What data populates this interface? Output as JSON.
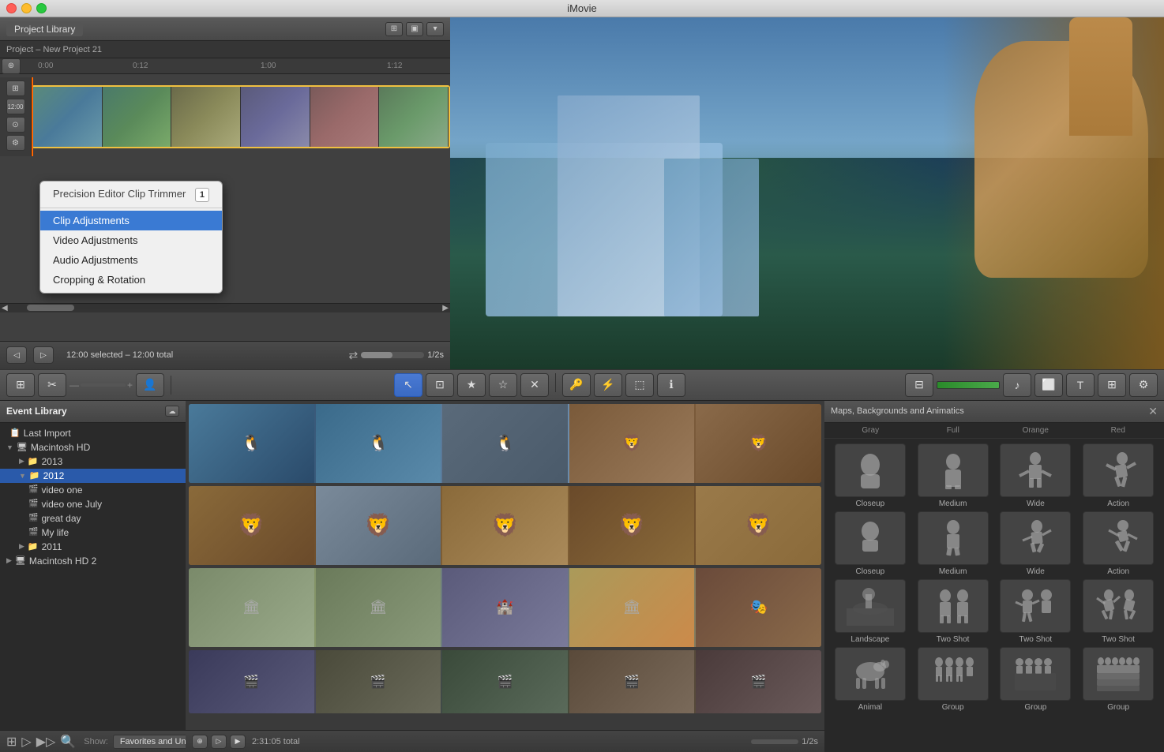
{
  "app": {
    "title": "iMovie",
    "window_controls": {
      "close": "close",
      "minimize": "minimize",
      "maximize": "maximize"
    }
  },
  "project": {
    "tab_label": "Project Library",
    "title": "Project – New Project 21",
    "timecodes": [
      "0:00",
      "0:12",
      "1:00",
      "1:12"
    ],
    "selected_time": "12:00 selected – 12:00 total",
    "speed": "1/2s"
  },
  "context_menu": {
    "header_line1": "Precision Editor",
    "header_line2": "Clip Trimmer",
    "badge": "1",
    "items": [
      {
        "label": "Clip Adjustments",
        "highlighted": true
      },
      {
        "label": "Video Adjustments",
        "highlighted": false
      },
      {
        "label": "Audio Adjustments",
        "highlighted": false
      },
      {
        "label": "Cropping & Rotation",
        "highlighted": false
      }
    ]
  },
  "toolbar": {
    "tools": [
      "arrow",
      "crop-overlay",
      "star-filled",
      "star-empty",
      "reject",
      "key",
      "wand",
      "crop",
      "info"
    ],
    "right_tools": [
      "grid",
      "green-bar",
      "music",
      "photo",
      "text",
      "expand",
      "settings"
    ]
  },
  "event_library": {
    "title": "Event Library",
    "items": [
      {
        "label": "Last Import",
        "level": 0,
        "type": "item",
        "arrow": ""
      },
      {
        "label": "Macintosh HD",
        "level": 0,
        "type": "folder",
        "arrow": "▼",
        "expanded": true
      },
      {
        "label": "2013",
        "level": 1,
        "type": "folder",
        "arrow": "▶",
        "expanded": false
      },
      {
        "label": "2012",
        "level": 1,
        "type": "folder",
        "arrow": "▼",
        "expanded": true,
        "selected": true
      },
      {
        "label": "video one",
        "level": 2,
        "type": "file",
        "arrow": ""
      },
      {
        "label": "video one July",
        "level": 2,
        "type": "file",
        "arrow": ""
      },
      {
        "label": "great day",
        "level": 2,
        "type": "file",
        "arrow": ""
      },
      {
        "label": "My life",
        "level": 2,
        "type": "file",
        "arrow": ""
      },
      {
        "label": "2011",
        "level": 1,
        "type": "folder",
        "arrow": "▶",
        "expanded": false
      },
      {
        "label": "Macintosh HD 2",
        "level": 0,
        "type": "folder",
        "arrow": "▶",
        "expanded": false
      }
    ],
    "bottom": {
      "show_label": "Show:",
      "show_value": "Favorites and Unmarked",
      "total": "2:31:05 total",
      "speed": "1/2s"
    }
  },
  "maps_panel": {
    "title": "Maps, Backgrounds and Animatics",
    "scroll_pos": 0,
    "categories": {
      "top_labels": [
        "Gray",
        "Full",
        "Orange",
        "Red"
      ],
      "rows": [
        {
          "items": [
            "Closeup",
            "Medium",
            "Wide",
            "Action"
          ],
          "row_type": "silhouette_single"
        },
        {
          "items": [
            "Closeup",
            "Medium",
            "Wide",
            "Action"
          ],
          "row_type": "silhouette_run"
        },
        {
          "items": [
            "Landscape",
            "Two Shot",
            "Two Shot",
            "Two Shot"
          ],
          "row_type": "landscape"
        },
        {
          "items": [
            "Animal",
            "Group",
            "Group",
            "Group"
          ],
          "row_type": "group"
        }
      ]
    }
  }
}
